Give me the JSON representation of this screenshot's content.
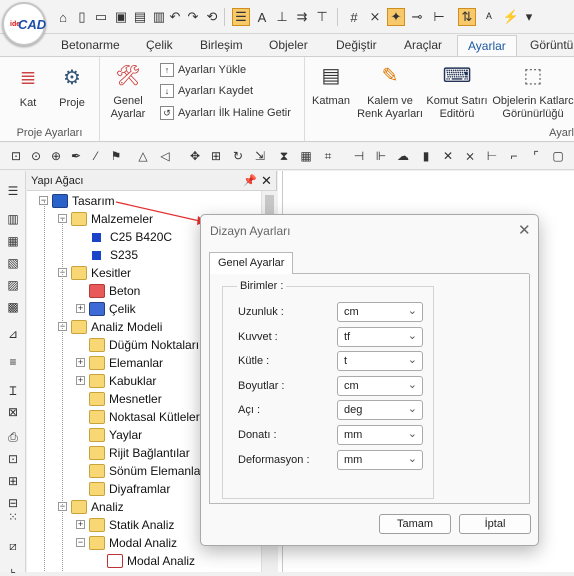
{
  "app": {
    "logo_text_small": "ide",
    "logo_text_main": "CAD"
  },
  "menu_tabs": [
    "Betonarme",
    "Çelik",
    "Birleşim",
    "Objeler",
    "Değiştir",
    "Araçlar",
    "Ayarlar",
    "Görüntü"
  ],
  "active_tab": "Ayarlar",
  "ribbon": {
    "kat_label": "Kat",
    "proje_label": "Proje",
    "genel_ayarlar_label_1": "Genel",
    "genel_ayarlar_label_2": "Ayarlar",
    "ayarlari_yukle": "Ayarları Yükle",
    "ayarlari_kaydet": "Ayarları Kaydet",
    "ilk_haline_getir": "Ayarları İlk Haline Getir",
    "katman_label": "Katman",
    "kalem_label_1": "Kalem ve",
    "kalem_label_2": "Renk Ayarları",
    "komut_label_1": "Komut Satırı",
    "komut_label_2": "Editörü",
    "objelerin_label_1": "Objelerin Katlarc",
    "objelerin_label_2": "Görünürlüğü",
    "group_proje_ayarlari": "Proje Ayarları",
    "group_ayarlar_cut": "Ayarl"
  },
  "panel": {
    "title": "Yapı Ağacı",
    "pin_icon": "pin-icon",
    "close_icon": "close-icon"
  },
  "tree": [
    {
      "label": "Tasarım",
      "level": 0,
      "icon": "design",
      "exp": "-"
    },
    {
      "label": "Malzemeler",
      "level": 1,
      "icon": "folder-blue",
      "exp": "-"
    },
    {
      "label": "C25 B420C",
      "level": 2,
      "icon": "square-blue",
      "exp": ""
    },
    {
      "label": "S235",
      "level": 2,
      "icon": "square-blue",
      "exp": ""
    },
    {
      "label": "Kesitler",
      "level": 1,
      "icon": "folder-grid",
      "exp": "-"
    },
    {
      "label": "Beton",
      "level": 2,
      "icon": "folder-red",
      "exp": ""
    },
    {
      "label": "Çelik",
      "level": 2,
      "icon": "folder-steel",
      "exp": "+"
    },
    {
      "label": "Analiz Modeli",
      "level": 1,
      "icon": "folder-model",
      "exp": "-"
    },
    {
      "label": "Düğüm Noktaları",
      "level": 2,
      "icon": "folder",
      "exp": ""
    },
    {
      "label": "Elemanlar",
      "level": 2,
      "icon": "folder",
      "exp": "+"
    },
    {
      "label": "Kabuklar",
      "level": 2,
      "icon": "folder",
      "exp": "+"
    },
    {
      "label": "Mesnetler",
      "level": 2,
      "icon": "folder-support",
      "exp": ""
    },
    {
      "label": "Noktasal Kütleler",
      "level": 2,
      "icon": "folder-mass",
      "exp": ""
    },
    {
      "label": "Yaylar",
      "level": 2,
      "icon": "folder-spring",
      "exp": ""
    },
    {
      "label": "Rijit Bağlantılar",
      "level": 2,
      "icon": "folder-rigid",
      "exp": ""
    },
    {
      "label": "Sönüm Elemanları",
      "level": 2,
      "icon": "folder-damper",
      "exp": ""
    },
    {
      "label": "Diyaframlar",
      "level": 2,
      "icon": "folder-diaphragm",
      "exp": ""
    },
    {
      "label": "Analiz",
      "level": 1,
      "icon": "folder-analysis",
      "exp": "-"
    },
    {
      "label": "Statik Analiz",
      "level": 2,
      "icon": "folder",
      "exp": "+"
    },
    {
      "label": "Modal Analiz",
      "level": 2,
      "icon": "folder-modal",
      "exp": "-"
    },
    {
      "label": "Modal Analiz",
      "level": 3,
      "icon": "modal-item",
      "exp": ""
    }
  ],
  "dialog": {
    "title": "Dizayn Ayarları",
    "tab": "Genel Ayarlar",
    "group": "Birimler :",
    "rows": [
      {
        "label": "Uzunluk :",
        "value": "cm"
      },
      {
        "label": "Kuvvet :",
        "value": "tf"
      },
      {
        "label": "Kütle :",
        "value": "t"
      },
      {
        "label": "Boyutlar :",
        "value": "cm"
      },
      {
        "label": "Açı :",
        "value": "deg"
      },
      {
        "label": "Donatı :",
        "value": "mm"
      },
      {
        "label": "Deformasyon :",
        "value": "mm"
      }
    ],
    "ok": "Tamam",
    "cancel": "İptal"
  },
  "colors": {
    "accent": "#1d5aa6",
    "arrow": "#e53030",
    "highlight": "#f7c96b"
  }
}
